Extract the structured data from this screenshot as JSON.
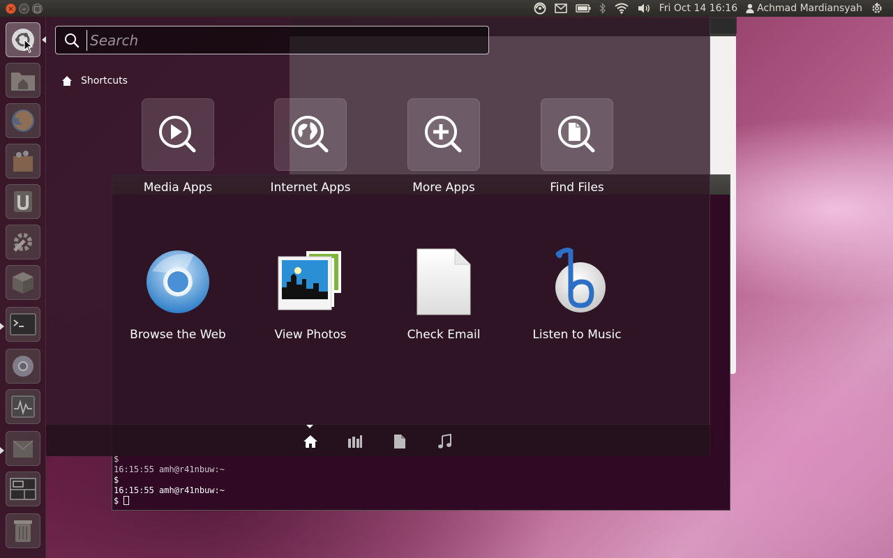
{
  "top_panel": {
    "clock": "Fri Oct 14 16:16",
    "user_name": "Achmad Mardiansyah",
    "close_glyph": "×",
    "minimize_glyph": "–",
    "maximize_glyph": "□"
  },
  "search": {
    "placeholder": "Search",
    "value": ""
  },
  "shortcuts": {
    "header": "Shortcuts"
  },
  "tiles_top": [
    {
      "label": "Media Apps",
      "icon": "media-apps-icon"
    },
    {
      "label": "Internet Apps",
      "icon": "internet-apps-icon"
    },
    {
      "label": "More Apps",
      "icon": "more-apps-icon"
    },
    {
      "label": "Find Files",
      "icon": "find-files-icon"
    }
  ],
  "tiles_bottom": [
    {
      "label": "Browse the Web",
      "icon": "chromium-icon"
    },
    {
      "label": "View Photos",
      "icon": "photos-icon"
    },
    {
      "label": "Check Email",
      "icon": "email-document-icon"
    },
    {
      "label": "Listen to Music",
      "icon": "banshee-icon"
    }
  ],
  "terminal": {
    "lines": [
      "$",
      "16:15:55 amh@r41nbuw:~",
      "$",
      "16:15:55 amh@r41nbuw:~",
      "$ "
    ]
  },
  "colors": {
    "accent": "#e0582e",
    "panel": "#3c3b37",
    "terminal_bg": "#300a24"
  }
}
